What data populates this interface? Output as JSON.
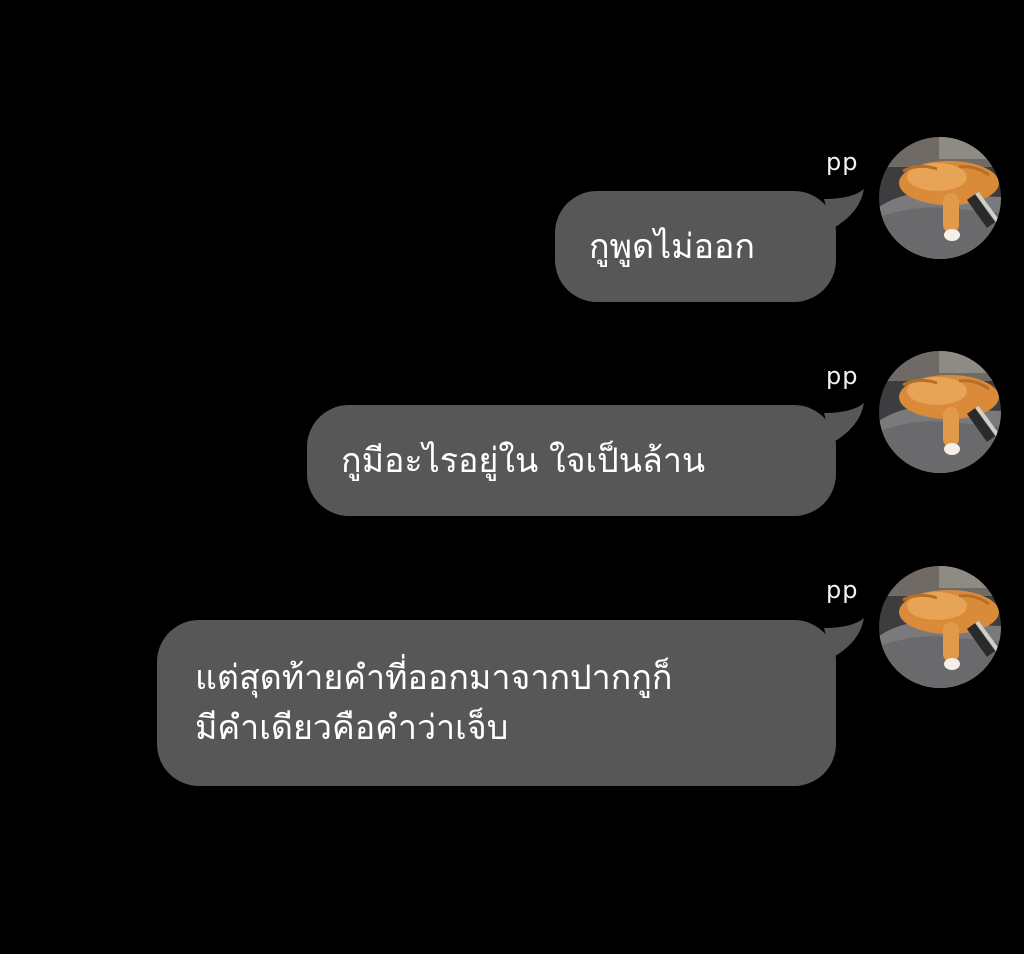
{
  "chat": {
    "messages": [
      {
        "sender": "pp",
        "avatar": "orange-cat-avatar",
        "lines": [
          "กูพูดไม่ออก"
        ]
      },
      {
        "sender": "pp",
        "avatar": "orange-cat-avatar",
        "lines": [
          "กูมีอะไรอยู่ใน ใจเป็นล้าน"
        ]
      },
      {
        "sender": "pp",
        "avatar": "orange-cat-avatar",
        "lines": [
          "แต่สุดท้ายคำที่ออกมาจากปากกูก็",
          "มีคำเดียวคือคำว่าเจ็บ"
        ]
      }
    ]
  },
  "colors": {
    "background": "#000000",
    "bubble": "#575757",
    "text": "#ffffff"
  }
}
